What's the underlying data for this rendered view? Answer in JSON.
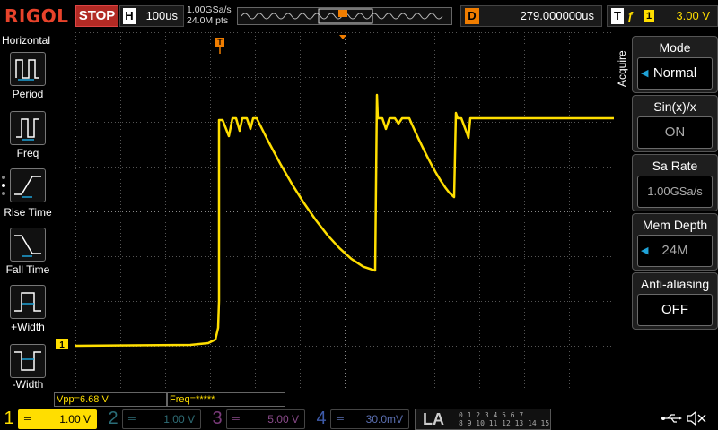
{
  "brand": "RIGOL",
  "run_state": "STOP",
  "horizontal": {
    "label": "H",
    "timebase": "100us"
  },
  "sampling": {
    "rate": "1.00GSa/s",
    "points": "24.0M pts"
  },
  "delay": {
    "label": "D",
    "value": "279.000000us"
  },
  "trigger": {
    "label": "T",
    "edge": "ƒ",
    "channel": "1",
    "level": "3.00 V"
  },
  "left_menu": {
    "title": "Horizontal",
    "items": [
      {
        "label": "Period"
      },
      {
        "label": "Freq"
      },
      {
        "label": "Rise Time"
      },
      {
        "label": "Fall Time"
      },
      {
        "label": "+Width"
      },
      {
        "label": "-Width"
      }
    ]
  },
  "right_menu": {
    "section": "Acquire",
    "items": [
      {
        "header": "Mode",
        "value": "Normal"
      },
      {
        "header": "Sin(x)/x",
        "value": "ON"
      },
      {
        "header": "Sa Rate",
        "value": "1.00GSa/s"
      },
      {
        "header": "Mem Depth",
        "value": "24M"
      },
      {
        "header": "Anti-aliasing",
        "value": "OFF"
      }
    ]
  },
  "measurements": [
    {
      "text": "Vpp=6.68 V"
    },
    {
      "text": "Freq=*****"
    }
  ],
  "channels": [
    {
      "num": "1",
      "scale": "1.00 V",
      "color": "#ffde00",
      "active": true
    },
    {
      "num": "2",
      "scale": "1.00 V",
      "color": "#00a9c0",
      "active": false
    },
    {
      "num": "3",
      "scale": "5.00 V",
      "color": "#c040c0",
      "active": false
    },
    {
      "num": "4",
      "scale": "30.0mV",
      "color": "#3c6cff",
      "active": false
    }
  ],
  "la": {
    "label": "LA",
    "bits_top": "0 1 2 3  4 5 6 7",
    "bits_bottom": "8 9 10 11  12 13 14 15"
  },
  "colors": {
    "trace": "#ffde00",
    "trigger_marker": "#f07d00",
    "grid": "#5a5a5a"
  },
  "markers": {
    "ch1_ground": "1",
    "trigger_pos": "T"
  }
}
